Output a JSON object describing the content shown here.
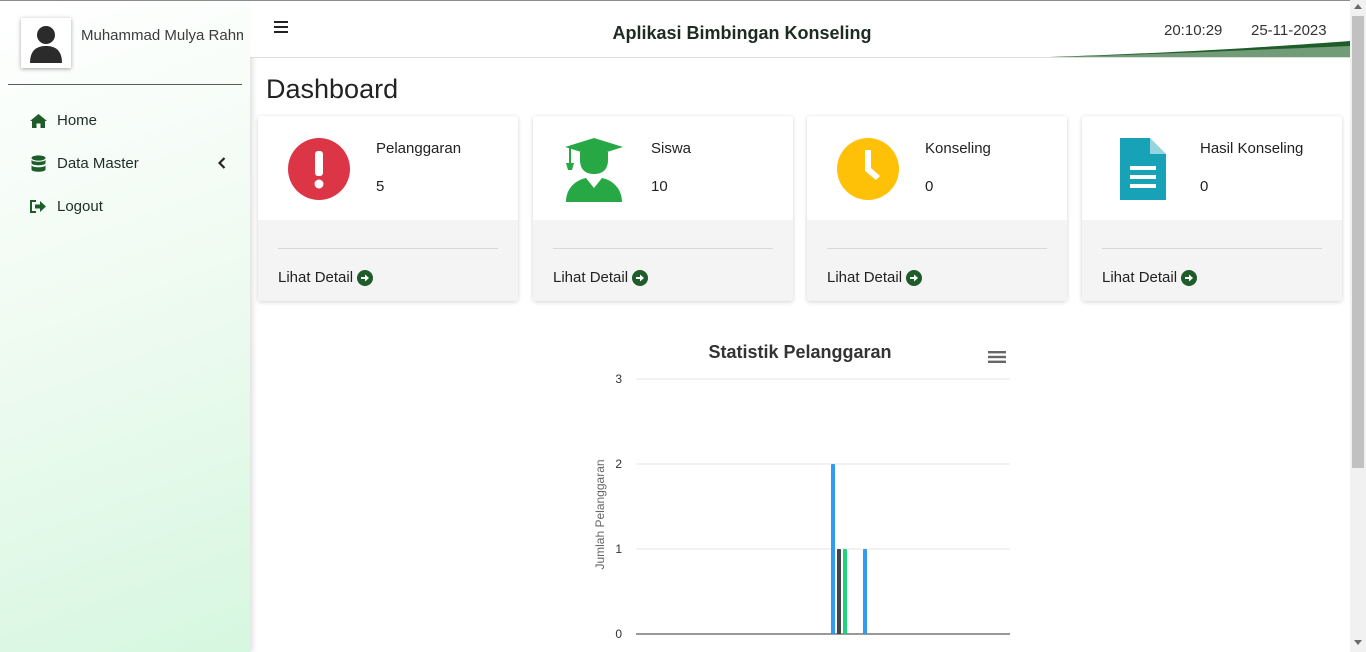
{
  "sidebar": {
    "user_name": "Muhammad Mulya Rahm",
    "nav": [
      {
        "label": "Home",
        "icon": "home-icon"
      },
      {
        "label": "Data Master",
        "icon": "database-icon"
      },
      {
        "label": "Logout",
        "icon": "logout-icon"
      }
    ]
  },
  "header": {
    "title": "Aplikasi Bimbingan Konseling",
    "time": "20:10:29",
    "date": "25-11-2023"
  },
  "main": {
    "page_title": "Dashboard",
    "cards": [
      {
        "label": "Pelanggaran",
        "value": "5",
        "link": "Lihat Detail",
        "icon": "exclamation-circle-icon",
        "color": "#dc3545"
      },
      {
        "label": "Siswa",
        "value": "10",
        "link": "Lihat Detail",
        "icon": "graduate-student-icon",
        "color": "#28a745"
      },
      {
        "label": "Konseling",
        "value": "0",
        "link": "Lihat Detail",
        "icon": "clock-icon",
        "color": "#ffc107"
      },
      {
        "label": "Hasil Konseling",
        "value": "0",
        "link": "Lihat Detail",
        "icon": "document-icon",
        "color": "#17a2b8"
      }
    ]
  },
  "colors": {
    "accent": "#1e5c2a",
    "link_arrow": "#1e5c2a"
  },
  "chart_data": {
    "type": "bar",
    "title": "Statistik Pelanggaran",
    "ylabel": "Jumlah Pelanggaran",
    "ylim": [
      0,
      3
    ],
    "yticks": [
      0,
      1,
      2,
      3
    ],
    "series": [
      {
        "values": [
          2
        ],
        "color": "#2f9cf2"
      },
      {
        "values": [
          1
        ],
        "color": "#434348"
      },
      {
        "values": [
          1
        ],
        "color": "#1fd47a"
      },
      {
        "values": [
          1
        ],
        "color": "#2f9cf2"
      }
    ]
  }
}
